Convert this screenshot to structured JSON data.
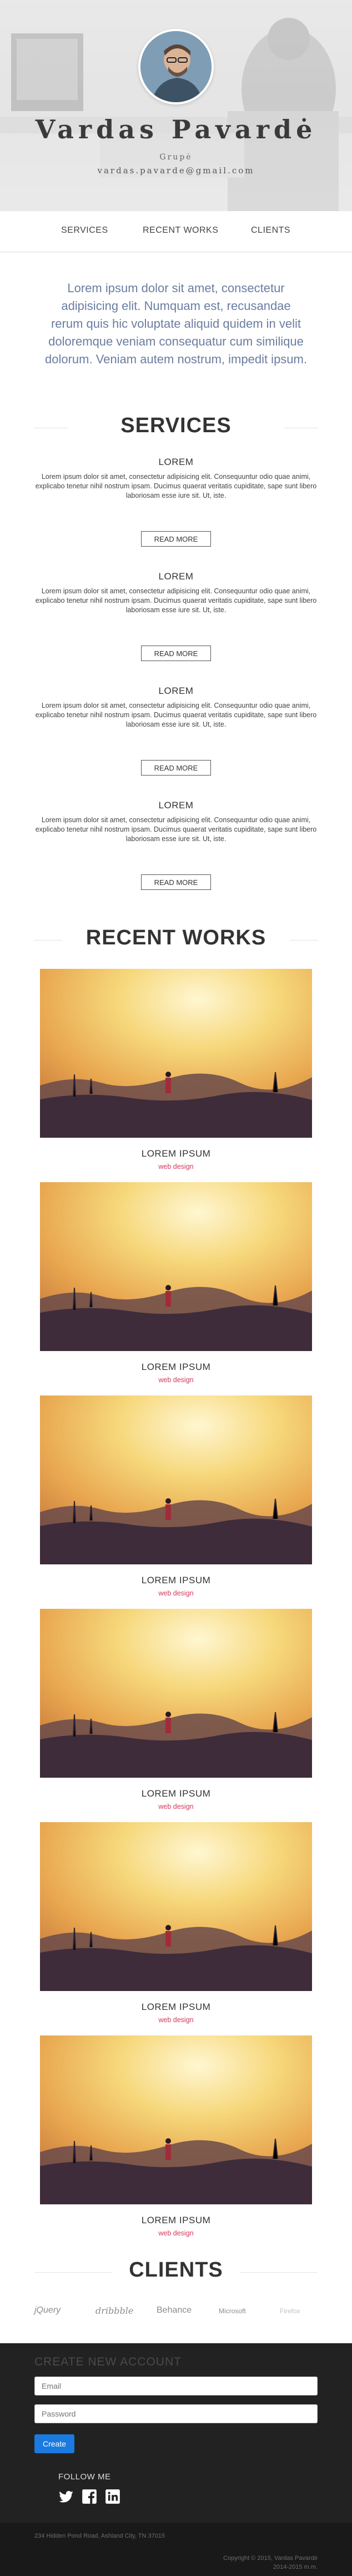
{
  "hero": {
    "name": "Vardas Pavardė",
    "subtitle": "Grupė",
    "email": "vardas.pavarde@gmail.com"
  },
  "nav": {
    "items": [
      {
        "label": "SERVICES"
      },
      {
        "label": "RECENT WORKS"
      },
      {
        "label": "CLIENTS"
      }
    ]
  },
  "intro": {
    "text": "Lorem ipsum dolor sit amet, consectetur adipisicing elit. Numquam est, recusandae rerum quis hic voluptate aliquid quidem in velit doloremque veniam consequatur cum similique dolorum. Veniam autem nostrum, impedit ipsum."
  },
  "services": {
    "title": "SERVICES",
    "read_more_label": "READ MORE",
    "items": [
      {
        "title": "LOREM",
        "text": "Lorem ipsum dolor sit amet, consectetur adipisicing elit. Consequuntur odio quae animi, explicabo tenetur nihil nostrum ipsam. Ducimus quaerat veritatis cupiditate, sape sunt libero laboriosam esse iure sit. Ut, iste."
      },
      {
        "title": "LOREM",
        "text": "Lorem ipsum dolor sit amet, consectetur adipisicing elit. Consequuntur odio quae animi, explicabo tenetur nihil nostrum ipsam. Ducimus quaerat veritatis cupiditate, sape sunt libero laboriosam esse iure sit. Ut, iste."
      },
      {
        "title": "LOREM",
        "text": "Lorem ipsum dolor sit amet, consectetur adipisicing elit. Consequuntur odio quae animi, explicabo tenetur nihil nostrum ipsam. Ducimus quaerat veritatis cupiditate, sape sunt libero laboriosam esse iure sit. Ut, iste."
      },
      {
        "title": "LOREM",
        "text": "Lorem ipsum dolor sit amet, consectetur adipisicing elit. Consequuntur odio quae animi, explicabo tenetur nihil nostrum ipsam. Ducimus quaerat veritatis cupiditate, sape sunt libero laboriosam esse iure sit. Ut, iste."
      }
    ]
  },
  "works": {
    "title": "RECENT WORKS",
    "items": [
      {
        "title": "LOREM IPSUM",
        "category": "web design"
      },
      {
        "title": "LOREM IPSUM",
        "category": "web design"
      },
      {
        "title": "LOREM IPSUM",
        "category": "web design"
      },
      {
        "title": "LOREM IPSUM",
        "category": "web design"
      },
      {
        "title": "LOREM IPSUM",
        "category": "web design"
      },
      {
        "title": "LOREM IPSUM",
        "category": "web design"
      }
    ]
  },
  "clients": {
    "title": "CLIENTS",
    "items": [
      {
        "label": "jQuery"
      },
      {
        "label": "dribbble"
      },
      {
        "label": "Behance"
      },
      {
        "label": "Microsoft"
      },
      {
        "label": "Firefox"
      }
    ]
  },
  "footer": {
    "heading": "CREATE NEW ACCOUNT",
    "email_placeholder": "Email",
    "password_placeholder": "Password",
    "create_label": "Create",
    "follow_label": "FOLLOW ME",
    "social_icons": [
      "twitter-icon",
      "facebook-icon",
      "linkedin-icon"
    ],
    "address": "234 Hidden Pond Road, Ashland City, TN 37015",
    "copyright": "Copyright © 2015, Vardas Pavardė",
    "rights": "2014-2015 m.m."
  },
  "colors": {
    "accent_pink": "#d23a5e",
    "button_blue": "#1a7ae0",
    "intro_blue": "#6a7da0",
    "footer_bg": "#222222"
  }
}
